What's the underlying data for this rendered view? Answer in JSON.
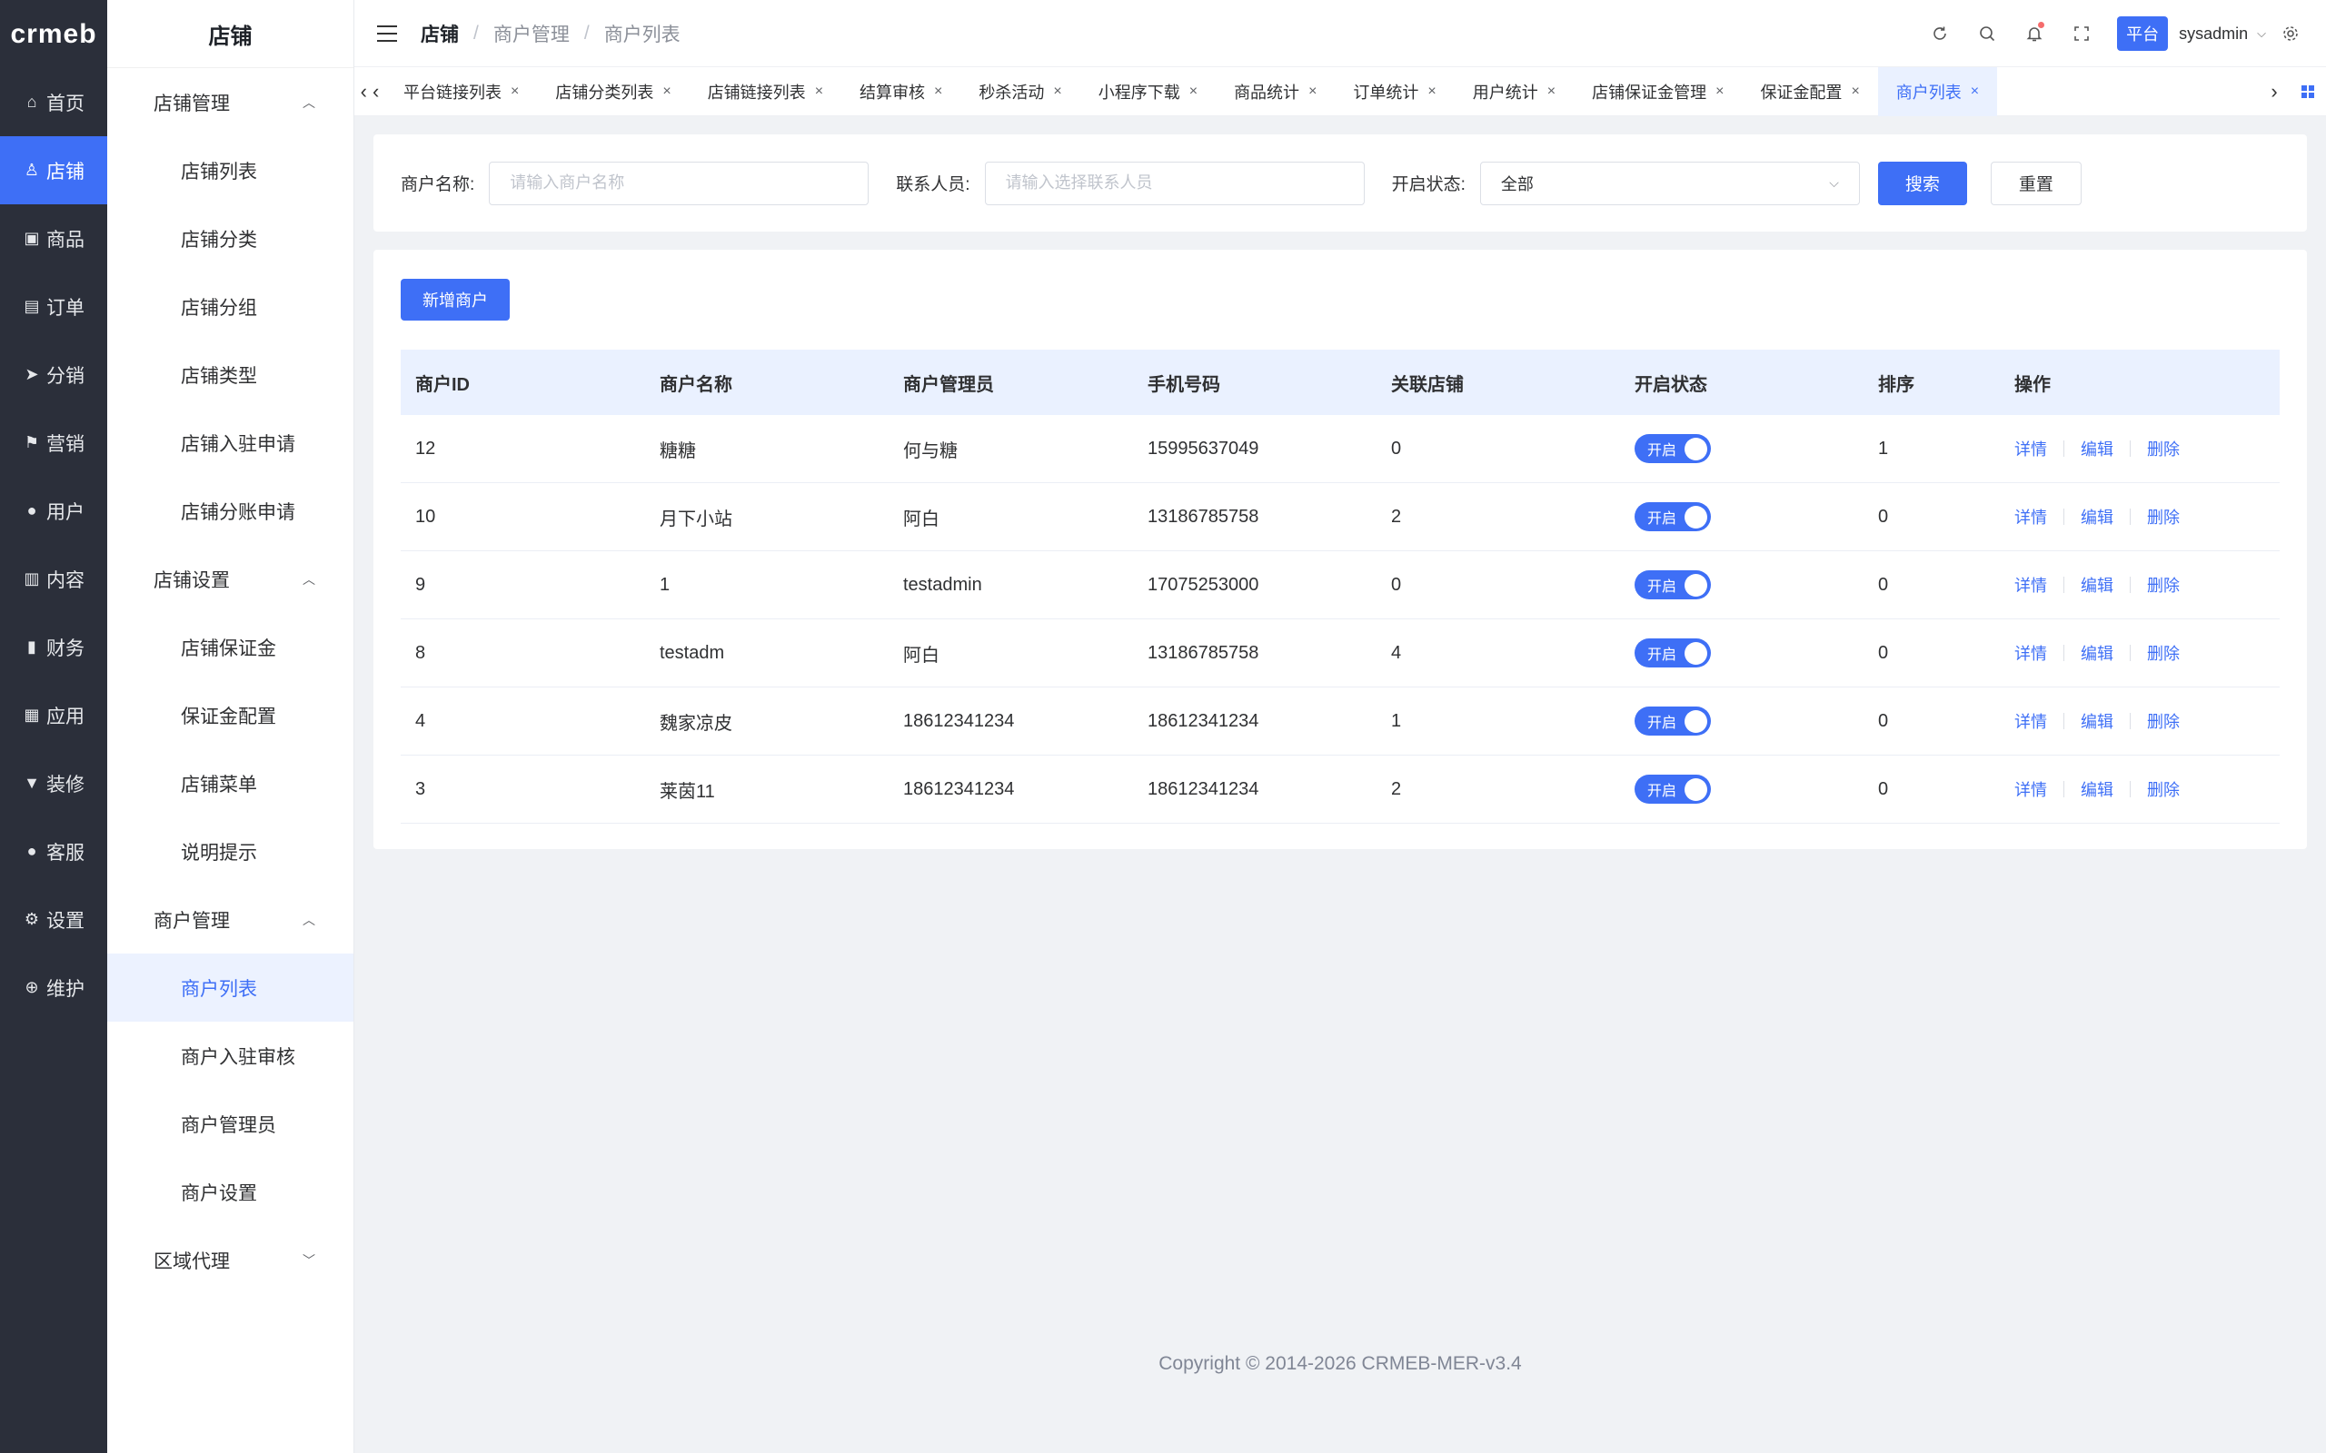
{
  "logo": "crmeb",
  "rail": [
    {
      "label": "首页",
      "icon": "home-icon",
      "glyph": "⌂"
    },
    {
      "label": "店铺",
      "icon": "store-icon",
      "glyph": "♙"
    },
    {
      "label": "商品",
      "icon": "bag-icon",
      "glyph": "▣"
    },
    {
      "label": "订单",
      "icon": "clipboard-icon",
      "glyph": "▤"
    },
    {
      "label": "分销",
      "icon": "send-icon",
      "glyph": "➤"
    },
    {
      "label": "营销",
      "icon": "flag-icon",
      "glyph": "⚑"
    },
    {
      "label": "用户",
      "icon": "user-icon",
      "glyph": "●"
    },
    {
      "label": "内容",
      "icon": "book-icon",
      "glyph": "▥"
    },
    {
      "label": "财务",
      "icon": "bar-chart-icon",
      "glyph": "▮"
    },
    {
      "label": "应用",
      "icon": "apps-grid-icon",
      "glyph": "▦"
    },
    {
      "label": "装修",
      "icon": "brush-icon",
      "glyph": "▼"
    },
    {
      "label": "客服",
      "icon": "support-icon",
      "glyph": "●"
    },
    {
      "label": "设置",
      "icon": "gear-icon",
      "glyph": "⚙"
    },
    {
      "label": "维护",
      "icon": "tool-icon",
      "glyph": "⊕"
    }
  ],
  "sidebar": {
    "title": "店铺",
    "groups": [
      {
        "label": "店铺管理",
        "expanded": true,
        "items": [
          "店铺列表",
          "店铺分类",
          "店铺分组",
          "店铺类型",
          "店铺入驻申请",
          "店铺分账申请"
        ]
      },
      {
        "label": "店铺设置",
        "expanded": true,
        "items": [
          "店铺保证金",
          "保证金配置",
          "店铺菜单",
          "说明提示"
        ]
      },
      {
        "label": "商户管理",
        "expanded": true,
        "items": [
          "商户列表",
          "商户入驻审核",
          "商户管理员",
          "商户设置"
        ]
      },
      {
        "label": "区域代理",
        "expanded": false,
        "items": []
      }
    ],
    "active_item": "商户列表"
  },
  "header": {
    "breadcrumb": [
      "店铺",
      "商户管理",
      "商户列表"
    ],
    "separator": "/",
    "platform_label": "平台",
    "username": "sysadmin"
  },
  "tabs": {
    "items": [
      "平台链接列表",
      "店铺分类列表",
      "店铺链接列表",
      "结算审核",
      "秒杀活动",
      "小程序下载",
      "商品统计",
      "订单统计",
      "用户统计",
      "店铺保证金管理",
      "保证金配置",
      "商户列表"
    ],
    "active": "商户列表"
  },
  "filter": {
    "name_label": "商户名称:",
    "name_placeholder": "请输入商户名称",
    "contact_label": "联系人员:",
    "contact_placeholder": "请输入选择联系人员",
    "status_label": "开启状态:",
    "status_value": "全部",
    "search_label": "搜索",
    "reset_label": "重置"
  },
  "table": {
    "add_label": "新增商户",
    "columns": [
      "商户ID",
      "商户名称",
      "商户管理员",
      "手机号码",
      "关联店铺",
      "开启状态",
      "排序",
      "操作"
    ],
    "switch_label": "开启",
    "actions": [
      "详情",
      "编辑",
      "删除"
    ],
    "rows": [
      {
        "id": "12",
        "name": "糖糖",
        "admin": "何与糖",
        "phone": "15995637049",
        "stores": "0",
        "enabled": true,
        "sort": "1"
      },
      {
        "id": "10",
        "name": "月下小站",
        "admin": "阿白",
        "phone": "13186785758",
        "stores": "2",
        "enabled": true,
        "sort": "0"
      },
      {
        "id": "9",
        "name": "1",
        "admin": "testadmin",
        "phone": "17075253000",
        "stores": "0",
        "enabled": true,
        "sort": "0"
      },
      {
        "id": "8",
        "name": "testadm",
        "admin": "阿白",
        "phone": "13186785758",
        "stores": "4",
        "enabled": true,
        "sort": "0"
      },
      {
        "id": "4",
        "name": "魏家凉皮",
        "admin": "18612341234",
        "phone": "18612341234",
        "stores": "1",
        "enabled": true,
        "sort": "0"
      },
      {
        "id": "3",
        "name": "莱茵11",
        "admin": "18612341234",
        "phone": "18612341234",
        "stores": "2",
        "enabled": true,
        "sort": "0"
      }
    ]
  },
  "footer": "Copyright © 2014-2026 CRMEB-MER-v3.4",
  "colors": {
    "accent": "#3e6ff6",
    "rail_bg": "#2b2f3a",
    "active_bg": "#ecf2ff"
  }
}
